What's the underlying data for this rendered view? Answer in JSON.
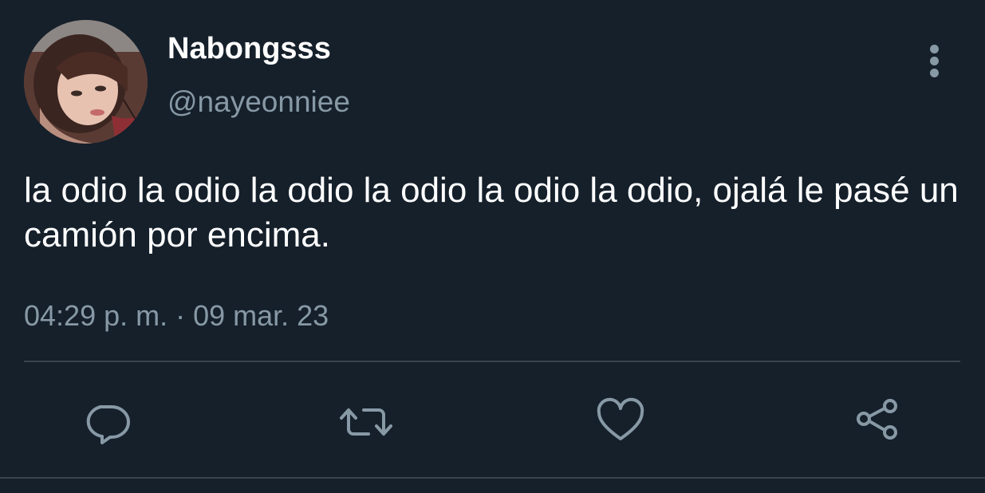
{
  "tweet": {
    "display_name": "Nabongsss",
    "handle": "@nayeonniee",
    "text": "la odio la odio la odio la odio la odio la odio, ojalá le pasé un camión por encima.",
    "timestamp": "04:29 p. m. · 09 mar. 23"
  },
  "actions": [
    {
      "icon": "reply-icon"
    },
    {
      "icon": "retweet-icon"
    },
    {
      "icon": "like-icon"
    },
    {
      "icon": "share-icon"
    }
  ],
  "colors": {
    "background": "#15202b",
    "primary_text": "#ffffff",
    "secondary_text": "#8899a6",
    "divider": "#38444d"
  }
}
